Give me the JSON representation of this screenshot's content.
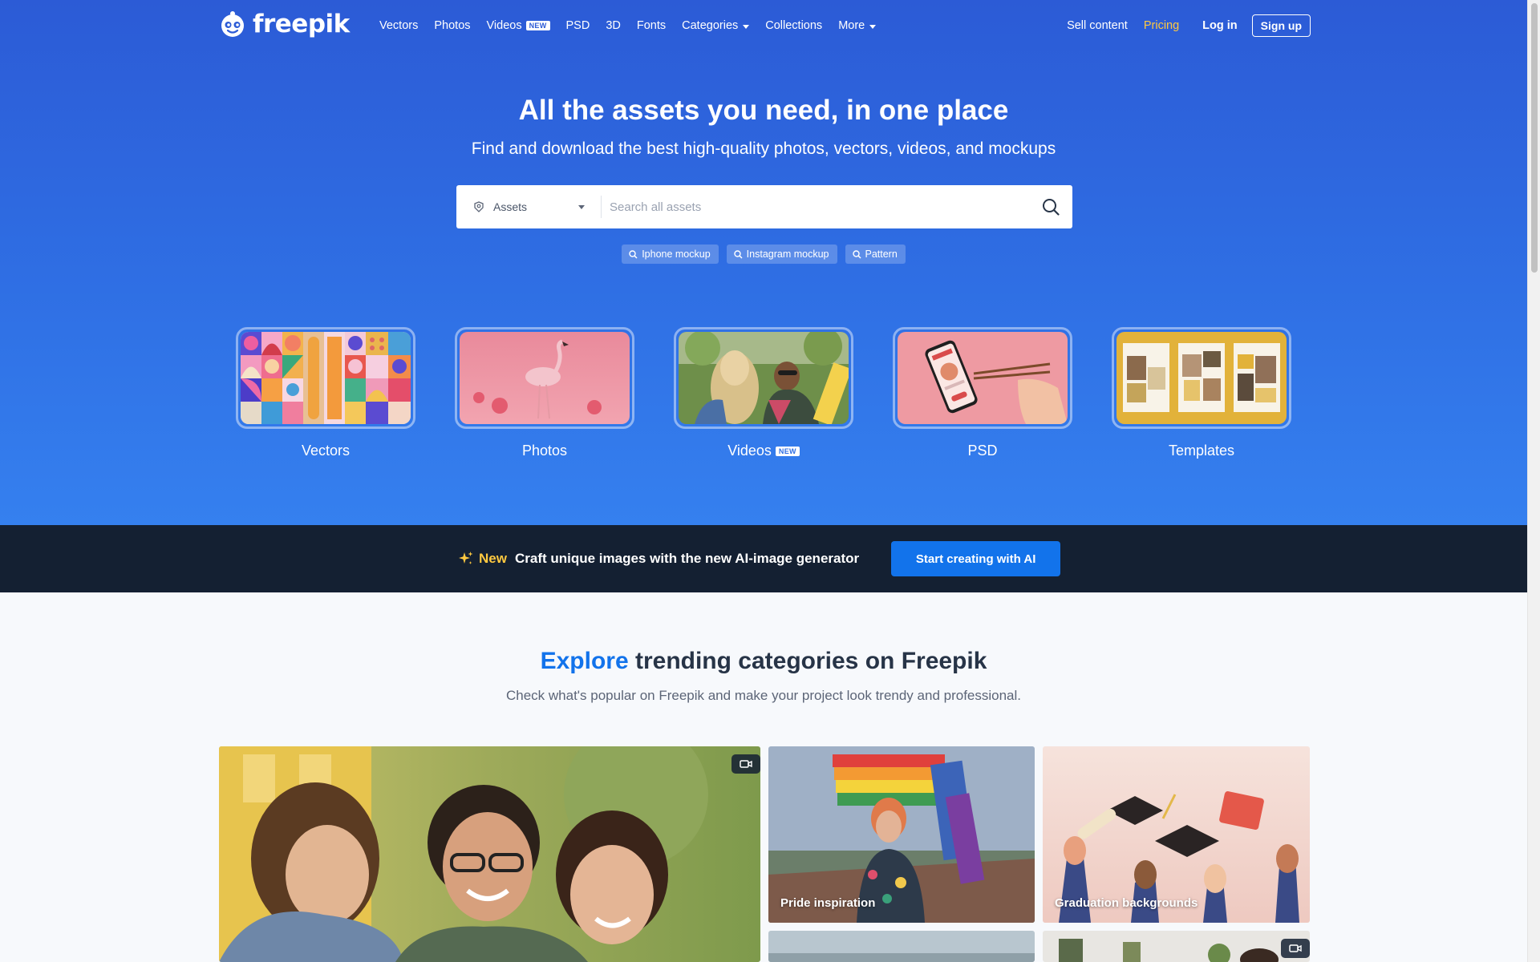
{
  "nav": {
    "logo_text": "freepik",
    "links": [
      {
        "label": "Vectors"
      },
      {
        "label": "Photos"
      },
      {
        "label": "Videos",
        "badge": "NEW"
      },
      {
        "label": "PSD"
      },
      {
        "label": "3D"
      },
      {
        "label": "Fonts"
      },
      {
        "label": "Categories",
        "dropdown": true
      },
      {
        "label": "Collections"
      },
      {
        "label": "More",
        "dropdown": true
      }
    ],
    "sell": "Sell content",
    "pricing": "Pricing",
    "login": "Log in",
    "signup": "Sign up"
  },
  "hero": {
    "title": "All the assets you need, in one place",
    "subtitle": "Find and download the best high-quality photos, vectors, videos, and mockups"
  },
  "search": {
    "asset_type": "Assets",
    "placeholder": "Search all assets",
    "suggestions": [
      "Iphone mockup",
      "Instagram mockup",
      "Pattern"
    ]
  },
  "categories": [
    {
      "label": "Vectors"
    },
    {
      "label": "Photos"
    },
    {
      "label": "Videos",
      "badge": "NEW"
    },
    {
      "label": "PSD"
    },
    {
      "label": "Templates"
    }
  ],
  "ai_banner": {
    "new_label": "New",
    "text": "Craft unique images with the new AI-image generator",
    "button": "Start creating with AI"
  },
  "explore": {
    "title_accent": "Explore",
    "title_rest": " trending categories on Freepik",
    "subtitle": "Check what's popular on Freepik and make your project look trendy and professional.",
    "tiles": [
      {
        "label": "",
        "video": true
      },
      {
        "label": "Pride inspiration",
        "video": false
      },
      {
        "label": "Graduation backgrounds",
        "video": false
      },
      {
        "label": "",
        "video": false
      },
      {
        "label": "",
        "video": true
      }
    ]
  },
  "colors": {
    "hero_top": "#2c5bd6",
    "hero_bottom": "#3580ef",
    "banner_bg": "#142032",
    "accent_blue": "#1273eb",
    "pricing_yellow": "#ffc940"
  }
}
